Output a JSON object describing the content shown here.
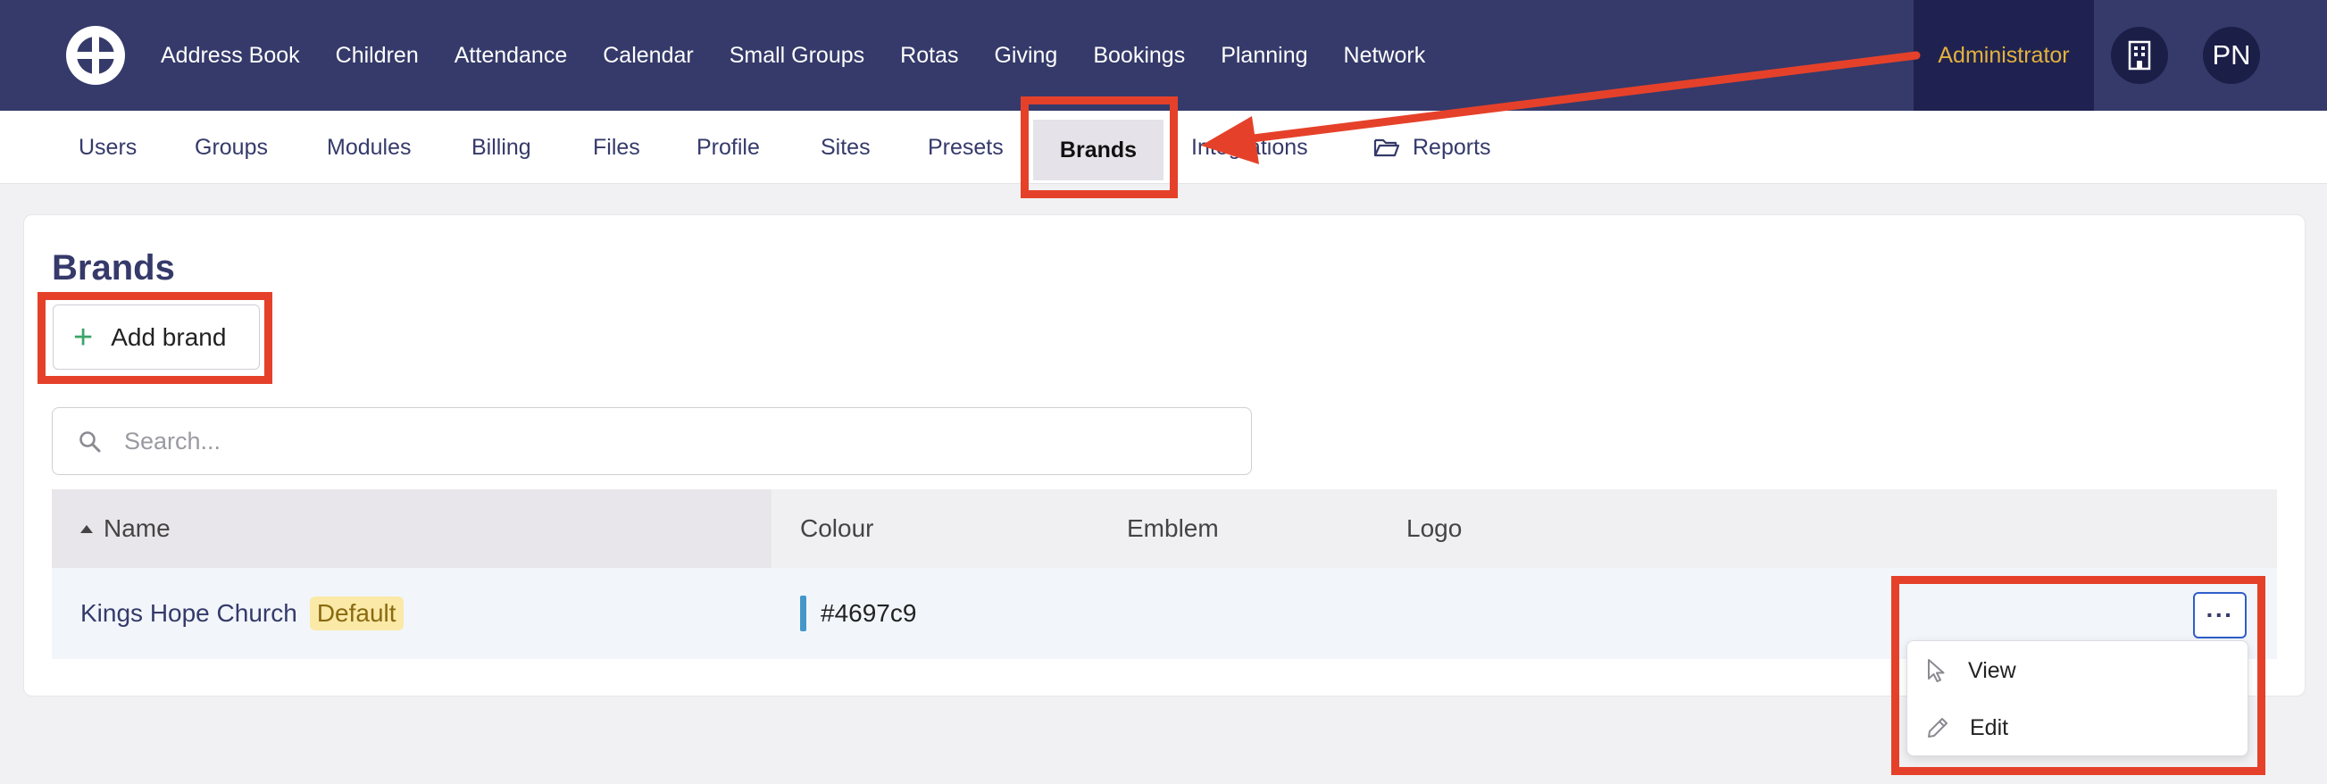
{
  "topnav": {
    "items": [
      {
        "label": "Address Book"
      },
      {
        "label": "Children"
      },
      {
        "label": "Attendance"
      },
      {
        "label": "Calendar"
      },
      {
        "label": "Small Groups"
      },
      {
        "label": "Rotas"
      },
      {
        "label": "Giving"
      },
      {
        "label": "Bookings"
      },
      {
        "label": "Planning"
      },
      {
        "label": "Network"
      }
    ],
    "admin_label": "Administrator",
    "avatar_initials": "PN",
    "logo_icon": "wheel-logo-icon",
    "org_icon": "building-icon"
  },
  "subnav": {
    "items": [
      {
        "label": "Users"
      },
      {
        "label": "Groups"
      },
      {
        "label": "Modules"
      },
      {
        "label": "Billing"
      },
      {
        "label": "Files"
      },
      {
        "label": "Profile"
      },
      {
        "label": "Sites"
      },
      {
        "label": "Presets"
      },
      {
        "label": "Brands"
      },
      {
        "label": "Integrations"
      },
      {
        "label": "Reports"
      }
    ],
    "active": "Brands"
  },
  "page": {
    "title": "Brands",
    "add_button_label": "Add brand",
    "search_placeholder": "Search..."
  },
  "table": {
    "columns": [
      "Name",
      "Colour",
      "Emblem",
      "Logo"
    ],
    "sort_column": "Name",
    "rows": [
      {
        "name": "Kings Hope Church",
        "badge": "Default",
        "colour": "#4697c9",
        "emblem": "",
        "logo": ""
      }
    ],
    "row_actions_label": "···"
  },
  "row_menu": {
    "items": [
      {
        "label": "View",
        "icon": "cursor-icon"
      },
      {
        "label": "Edit",
        "icon": "pencil-icon"
      }
    ]
  },
  "colors": {
    "nav_bg": "#353a6a",
    "accent_gold": "#e3b23c",
    "highlight": "#e5412a",
    "brand_swatch": "#4697c9"
  }
}
